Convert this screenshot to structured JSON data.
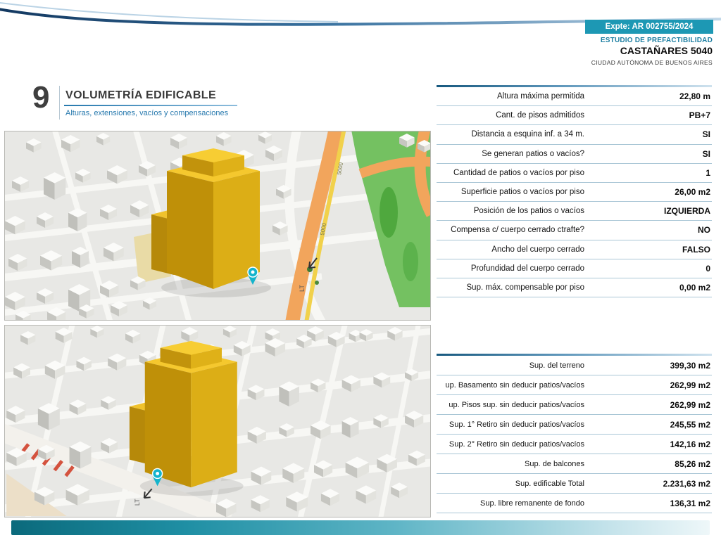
{
  "header": {
    "expte_label": "Expte: AR 002755/2024",
    "study_type": "ESTUDIO DE PREFACTIBILIDAD",
    "address": "CASTAÑARES 5040",
    "city": "CIUDAD AUTÓNOMA DE BUENOS AIRES"
  },
  "section": {
    "number": "9",
    "title": "VOLUMETRÍA EDIFICABLE",
    "subtitle": "Alturas, extensiones, vacíos y compensaciones"
  },
  "tables": {
    "parameters": {
      "rows": [
        {
          "label": "Altura máxima permitida",
          "value": "22,80 m"
        },
        {
          "label": "Cant. de pisos admitidos",
          "value": "PB+7"
        },
        {
          "label": "Distancia a esquina inf. a 34 m.",
          "value": "SI"
        },
        {
          "label": "Se generan patios o vacíos?",
          "value": "SI"
        },
        {
          "label": "Cantidad de patios o vacíos por piso",
          "value": "1"
        },
        {
          "label": "Superficie patios o vacíos por piso",
          "value": "26,00 m2"
        },
        {
          "label": "Posición de los patios o vacíos",
          "value": "IZQUIERDA"
        },
        {
          "label": "Compensa c/ cuerpo cerrado ctrafte?",
          "value": "NO"
        },
        {
          "label": "Ancho del cuerpo cerrado",
          "value": "FALSO"
        },
        {
          "label": "Profundidad del cuerpo cerrado",
          "value": "0"
        },
        {
          "label": "Sup. máx. compensable por piso",
          "value": "0,00 m2"
        }
      ]
    },
    "surfaces": {
      "rows": [
        {
          "label": "Sup. del terreno",
          "value": "399,30 m2"
        },
        {
          "label": "up. Basamento sin deducir patios/vacíos",
          "value": "262,99 m2"
        },
        {
          "label": "up. Pisos sup. sin deducir patios/vacíos",
          "value": "262,99 m2"
        },
        {
          "label": "Sup. 1° Retiro sin deducir patios/vacíos",
          "value": "245,55 m2"
        },
        {
          "label": "Sup. 2° Retiro sin deducir patios/vacíos",
          "value": "142,16 m2"
        },
        {
          "label": "Sup. de balcones",
          "value": "85,26 m2"
        },
        {
          "label": "Sup. edificable Total",
          "value": "2.231,63 m2"
        },
        {
          "label": "Sup. libre remanente de fondo",
          "value": "136,31 m2"
        }
      ]
    }
  },
  "maps": {
    "map1": {
      "road_label": "5000",
      "lt_label": "LT"
    },
    "map2": {
      "lt_label": "LT"
    }
  },
  "colors": {
    "accent_teal": "#1d98b4",
    "header_blue": "#1d7fa2",
    "table_line": "#a9c6d6",
    "building_gold": "#dcae16",
    "park_green": "#74c161",
    "road_orange": "#f2a55c"
  }
}
